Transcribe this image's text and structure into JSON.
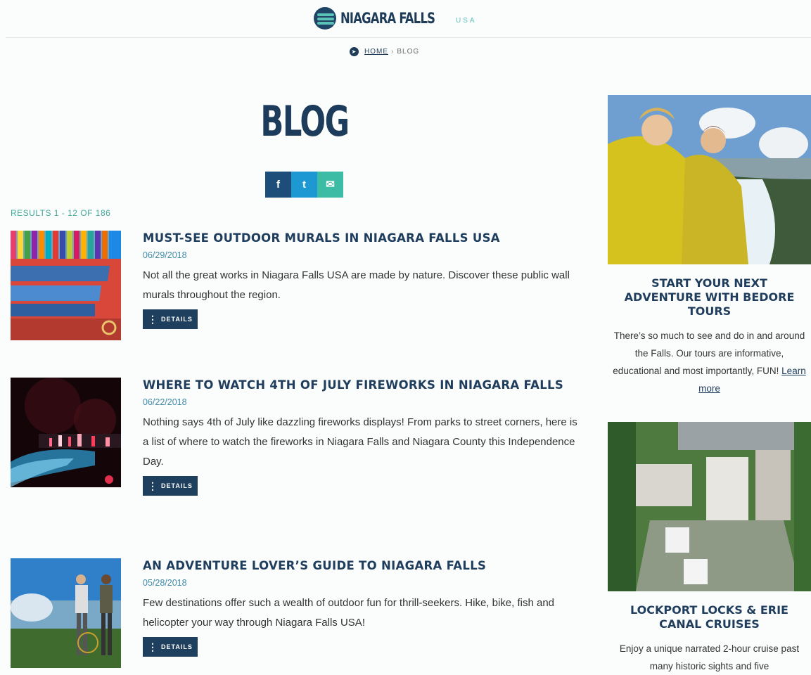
{
  "brand": {
    "name": "NIAGARA FALLS",
    "suffix": "USA"
  },
  "breadcrumb": {
    "home": "HOME",
    "separator": "›",
    "current": "BLOG"
  },
  "page": {
    "title": "BLOG",
    "results": "RESULTS 1 - 12 OF 186"
  },
  "share": {
    "facebook": "f",
    "twitter": "t",
    "email": "✉"
  },
  "posts": [
    {
      "title": "MUST-SEE OUTDOOR MURALS IN NIAGARA FALLS USA",
      "date": "06/29/2018",
      "excerpt": "Not all the great works in Niagara Falls USA are made by nature. Discover these public wall murals throughout the region.",
      "button": "DETAILS"
    },
    {
      "title": "WHERE TO WATCH 4TH OF JULY FIREWORKS IN NIAGARA FALLS",
      "date": "06/22/2018",
      "excerpt": "Nothing says 4th of July like dazzling fireworks displays! From parks to street corners, here is a list of where to watch the fireworks in Niagara Falls and Niagara County this Independence Day.",
      "button": "DETAILS"
    },
    {
      "title": "AN ADVENTURE LOVER’S GUIDE TO NIAGARA FALLS",
      "date": "05/28/2018",
      "excerpt": "Few destinations offer such a wealth of outdoor fun for thrill-seekers. Hike, bike, fish and helicopter your way through Niagara Falls USA!",
      "button": "DETAILS"
    }
  ],
  "sidebar": [
    {
      "title": "START YOUR NEXT ADVENTURE WITH BEDORE TOURS",
      "text": "There’s so much to see and do in and around the Falls. Our tours are informative, educational and most importantly, FUN!",
      "link": "Learn more"
    },
    {
      "title": "LOCKPORT LOCKS & ERIE CANAL CRUISES",
      "text": "Enjoy a unique narrated 2-hour cruise past many historic sights and five"
    }
  ],
  "colors": {
    "navy": "#1e3b57",
    "teal": "#5ac1b6",
    "date_blue": "#3f8ba8"
  }
}
